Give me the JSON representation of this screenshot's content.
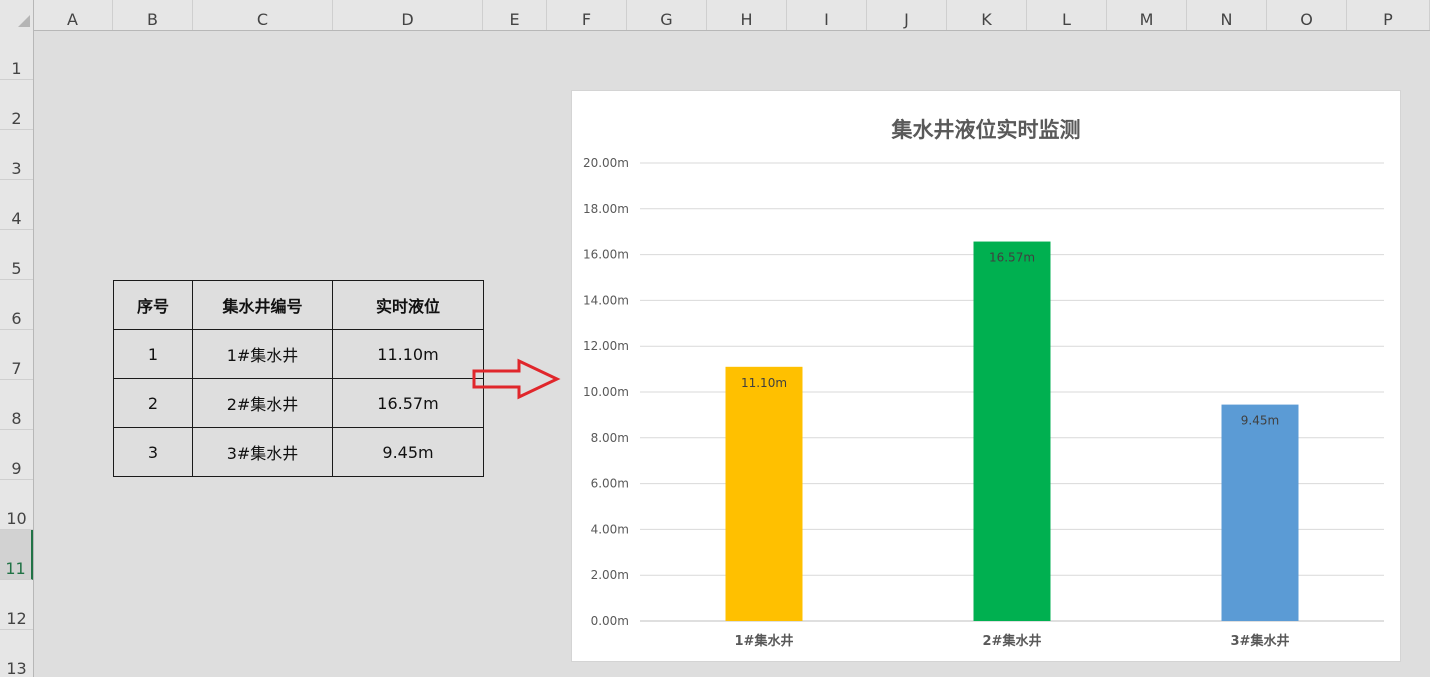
{
  "columns": [
    "A",
    "B",
    "C",
    "D",
    "E",
    "F",
    "G",
    "H",
    "I",
    "J",
    "K",
    "L",
    "M",
    "N",
    "O",
    "P"
  ],
  "rows": [
    "1",
    "2",
    "3",
    "4",
    "5",
    "6",
    "7",
    "8",
    "9",
    "10",
    "11",
    "12",
    "13"
  ],
  "selected_row": "11",
  "table": {
    "headers": [
      "序号",
      "集水井编号",
      "实时液位"
    ],
    "rows": [
      [
        "1",
        "1#集水井",
        "11.10m"
      ],
      [
        "2",
        "2#集水井",
        "16.57m"
      ],
      [
        "3",
        "3#集水井",
        "9.45m"
      ]
    ]
  },
  "colors": {
    "bar_1": "#ffc000",
    "bar_2": "#00b050",
    "bar_3": "#5b9bd5",
    "arrow": "#e0262b",
    "selection": "#217346"
  },
  "chart_data": {
    "type": "bar",
    "title": "集水井液位实时监测",
    "categories": [
      "1#集水井",
      "2#集水井",
      "3#集水井"
    ],
    "values": [
      11.1,
      16.57,
      9.45
    ],
    "data_labels": [
      "11.10m",
      "16.57m",
      "9.45m"
    ],
    "ylim": [
      0,
      20
    ],
    "yticks": [
      "0.00m",
      "2.00m",
      "4.00m",
      "6.00m",
      "8.00m",
      "10.00m",
      "12.00m",
      "14.00m",
      "16.00m",
      "18.00m",
      "20.00m"
    ],
    "grid": true,
    "legend": "none"
  }
}
